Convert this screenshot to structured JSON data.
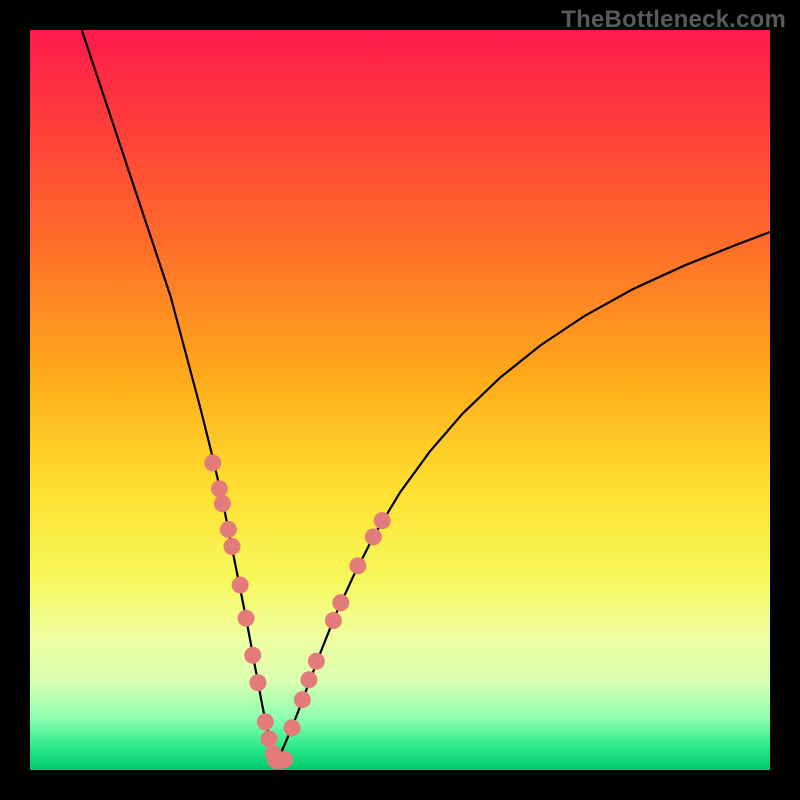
{
  "watermark": "TheBottleneck.com",
  "colors": {
    "frame": "#000000",
    "curve": "#000000",
    "dot": "#e47b7b",
    "gradient_top": "#ff1a4d",
    "gradient_bottom": "#00c96e"
  },
  "chart_data": {
    "type": "line",
    "title": "",
    "xlabel": "",
    "ylabel": "",
    "xlim": [
      0,
      100
    ],
    "ylim": [
      0,
      100
    ],
    "grid": false,
    "legend": false,
    "series": [
      {
        "name": "left-branch",
        "x": [
          7,
          10,
          13,
          16,
          19,
          21,
          23,
          24.5,
          25.8,
          26.8,
          27.7,
          28.5,
          29.2,
          29.8,
          30.3,
          30.8,
          31.2,
          31.6,
          32.0,
          32.3,
          32.6,
          32.9,
          33.2
        ],
        "y": [
          100,
          91,
          82,
          73,
          64,
          56.5,
          49,
          43,
          37.5,
          32.5,
          28,
          24,
          20.5,
          17.3,
          14.5,
          12,
          9.7,
          7.7,
          6.0,
          4.6,
          3.4,
          2.2,
          1.1
        ]
      },
      {
        "name": "right-branch",
        "x": [
          33.2,
          34.0,
          35.0,
          36.2,
          37.6,
          39.3,
          41.3,
          43.7,
          46.5,
          50,
          54,
          58.5,
          63.5,
          69,
          75,
          81.5,
          88.5,
          95.5,
          100
        ],
        "y": [
          1.1,
          2.5,
          4.8,
          7.8,
          11.5,
          16,
          21,
          26.2,
          31.7,
          37.5,
          43,
          48.2,
          53,
          57.4,
          61.4,
          65,
          68.2,
          71,
          72.7
        ]
      }
    ],
    "annotations": {
      "dots": [
        {
          "x": 24.7,
          "y": 41.5
        },
        {
          "x": 25.6,
          "y": 38.0
        },
        {
          "x": 26.0,
          "y": 36.0
        },
        {
          "x": 26.8,
          "y": 32.5
        },
        {
          "x": 27.3,
          "y": 30.2
        },
        {
          "x": 28.4,
          "y": 25.0
        },
        {
          "x": 29.2,
          "y": 20.5
        },
        {
          "x": 30.1,
          "y": 15.5
        },
        {
          "x": 30.8,
          "y": 11.8
        },
        {
          "x": 31.8,
          "y": 6.5
        },
        {
          "x": 32.3,
          "y": 4.2
        },
        {
          "x": 32.9,
          "y": 2.2
        },
        {
          "x": 33.2,
          "y": 1.3
        },
        {
          "x": 33.8,
          "y": 1.3
        },
        {
          "x": 34.4,
          "y": 1.4
        },
        {
          "x": 35.4,
          "y": 5.7
        },
        {
          "x": 36.8,
          "y": 9.5
        },
        {
          "x": 37.7,
          "y": 12.2
        },
        {
          "x": 38.7,
          "y": 14.7
        },
        {
          "x": 41.0,
          "y": 20.2
        },
        {
          "x": 42.0,
          "y": 22.6
        },
        {
          "x": 44.3,
          "y": 27.6
        },
        {
          "x": 46.4,
          "y": 31.5
        },
        {
          "x": 47.6,
          "y": 33.7
        }
      ]
    }
  }
}
